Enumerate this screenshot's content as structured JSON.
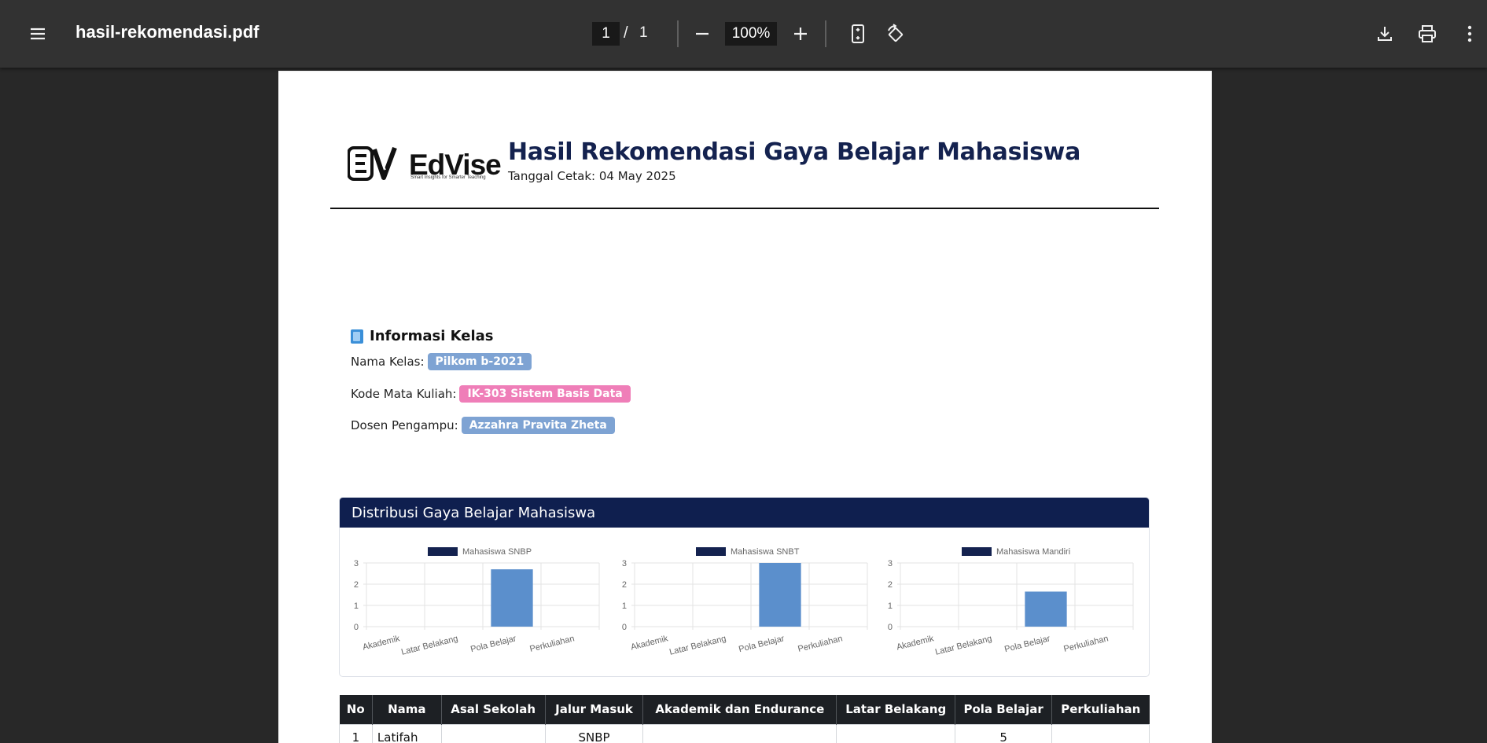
{
  "toolbar": {
    "file_name": "hasil-rekomendasi.pdf",
    "page_current": "1",
    "page_separator": "/",
    "page_total": "1",
    "zoom": "100%",
    "icons": [
      "menu-icon",
      "minus-icon",
      "plus-icon",
      "fit-page-icon",
      "rotate-icon",
      "download-icon",
      "print-icon",
      "more-vert-icon"
    ]
  },
  "report": {
    "brand": "EdVise",
    "brand_tagline": "Smart Insights for Smarter Teaching",
    "title": "Hasil Rekomendasi Gaya Belajar Mahasiswa",
    "print_date": "Tanggal Cetak: 04 May 2025"
  },
  "info": {
    "heading": "Informasi Kelas",
    "class_label": "Nama Kelas:",
    "class_value": "Pilkom b-2021",
    "course_label": "Kode Mata Kuliah:",
    "course_value": "IK-303 Sistem Basis Data",
    "lecturer_label": "Dosen Pengampu:",
    "lecturer_value": "Azzahra Pravita Zheta"
  },
  "distribution": {
    "heading": "Distribusi Gaya Belajar Mahasiswa"
  },
  "chart_data": [
    {
      "type": "bar",
      "categories": [
        "Akademik",
        "Latar Belakang",
        "Pola Belajar",
        "Perkuliahan"
      ],
      "series": [
        {
          "name": "Mahasiswa SNBP",
          "values": [
            0,
            0,
            2.7,
            0
          ]
        }
      ],
      "ylim": [
        0,
        3
      ],
      "yticks": [
        "3",
        "2",
        "1",
        "0"
      ],
      "legend": "top-center",
      "grid": true,
      "color": "#5b8fcc",
      "legend_color": "#14224f"
    },
    {
      "type": "bar",
      "categories": [
        "Akademik",
        "Latar Belakang",
        "Pola Belajar",
        "Perkuliahan"
      ],
      "series": [
        {
          "name": "Mahasiswa SNBT",
          "values": [
            0,
            0,
            3,
            0
          ]
        }
      ],
      "ylim": [
        0,
        3
      ],
      "yticks": [
        "3",
        "2",
        "1",
        "0"
      ],
      "legend": "top-center",
      "grid": true,
      "color": "#5b8fcc",
      "legend_color": "#14224f"
    },
    {
      "type": "bar",
      "categories": [
        "Akademik",
        "Latar Belakang",
        "Pola Belajar",
        "Perkuliahan"
      ],
      "series": [
        {
          "name": "Mahasiswa Mandiri",
          "values": [
            0,
            0,
            1.65,
            0
          ]
        }
      ],
      "ylim": [
        0,
        3
      ],
      "yticks": [
        "3",
        "2",
        "1",
        "0"
      ],
      "legend": "top-center",
      "grid": true,
      "color": "#5b8fcc",
      "legend_color": "#14224f"
    }
  ],
  "table": {
    "headers": [
      "No",
      "Nama",
      "Asal Sekolah",
      "Jalur Masuk",
      "Akademik dan Endurance",
      "Latar Belakang",
      "Pola Belajar",
      "Perkuliahan"
    ],
    "rows": [
      [
        "1",
        "Latifah",
        "",
        "SNBP",
        "",
        "",
        "5",
        ""
      ]
    ]
  }
}
